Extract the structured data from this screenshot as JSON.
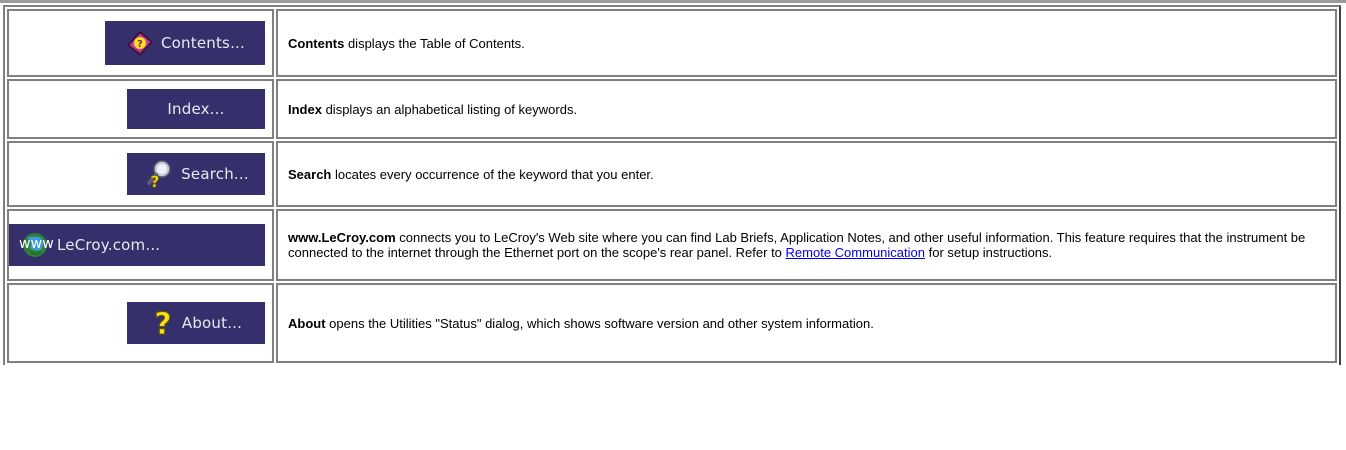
{
  "rows": [
    {
      "icon": "book-help-icon",
      "button_label": "Contents...",
      "keyword": "Contents",
      "text": " displays the Table of Contents."
    },
    {
      "icon": "",
      "button_label": "Index...",
      "keyword": "Index",
      "text": " displays an alphabetical listing of keywords."
    },
    {
      "icon": "search-key-icon",
      "button_label": "Search...",
      "keyword": "Search",
      "text": " locates every occurrence of the keyword that you enter."
    },
    {
      "icon": "www-globe-icon",
      "icon_text": "www",
      "button_label": "LeCroy.com...",
      "keyword": "www.LeCroy.com",
      "text": " connects you to LeCroy's Web site where you can find Lab Briefs, Application Notes, and other useful information. This feature requires that the instrument be connected to the internet through the Ethernet port on the scope's rear panel. Refer to ",
      "link_text": "Remote Communication",
      "text_after": " for setup instructions."
    },
    {
      "icon": "question-mark-icon",
      "button_label": "About...",
      "keyword": "About",
      "text": " opens the Utilities \"Status\" dialog, which shows software version and other system information."
    }
  ],
  "colors": {
    "button_bg": "#35306b",
    "button_text": "#e8e8ef",
    "link": "#0000ee",
    "border": "#808080"
  }
}
